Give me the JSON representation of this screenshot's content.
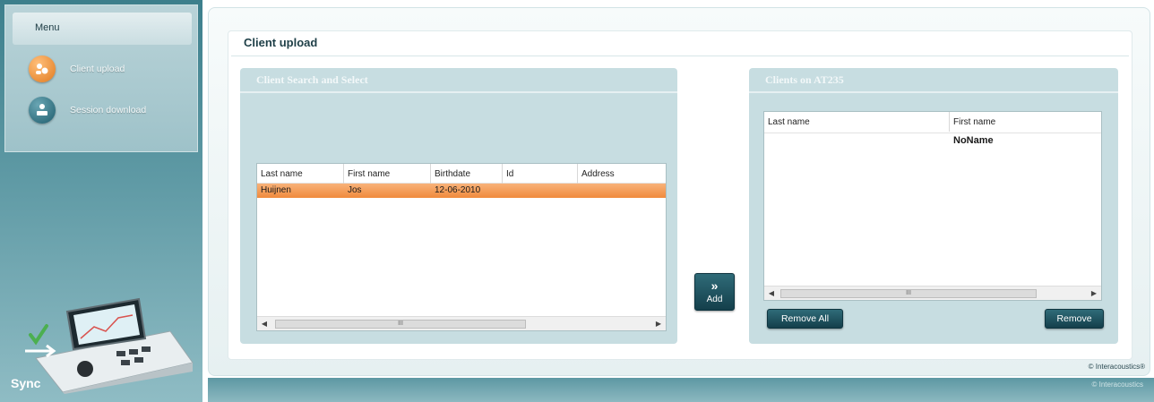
{
  "sidebar": {
    "menu_title": "Menu",
    "items": [
      {
        "label": "Client upload",
        "icon": "client-upload-icon"
      },
      {
        "label": "Session download",
        "icon": "session-download-icon"
      }
    ],
    "brand_label": "Sync"
  },
  "page": {
    "title": "Client upload"
  },
  "client_search": {
    "title": "Client Search and Select",
    "columns": [
      "Last name",
      "First name",
      "Birthdate",
      "Id",
      "Address"
    ],
    "rows": [
      {
        "last_name": "Huijnen",
        "first_name": "Jos",
        "birthdate": "12-06-2010",
        "id": "",
        "address": "",
        "selected": true
      }
    ],
    "scroll_thumb": "III"
  },
  "add_button": {
    "chevron": "»",
    "label": "Add"
  },
  "clients_on_device": {
    "title": "Clients on AT235",
    "columns": [
      "Last name",
      "First name"
    ],
    "rows": [
      {
        "last_name": "",
        "first_name": "NoName"
      }
    ],
    "scroll_thumb": "III",
    "remove_all_label": "Remove All",
    "remove_label": "Remove"
  },
  "footer": {
    "copyright": "© Interacoustics®",
    "text": "© Interacoustics"
  },
  "colors": {
    "accent_teal": "#1e5d6d",
    "selection_orange": "#f08a3c",
    "panel_bg": "#c7dde1"
  }
}
